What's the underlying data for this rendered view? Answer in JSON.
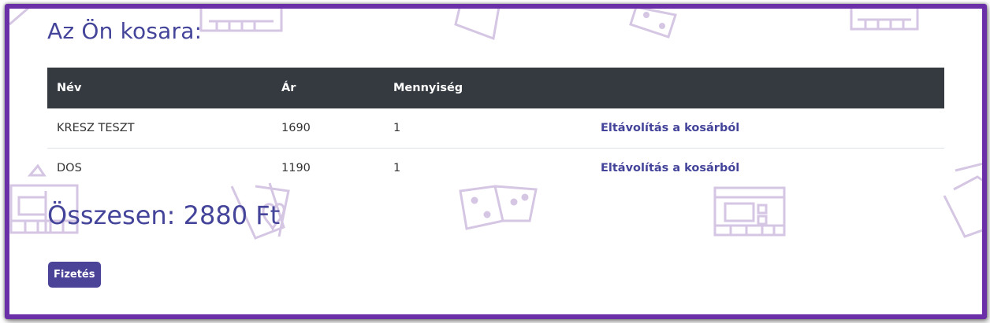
{
  "cart": {
    "title": "Az Ön kosara:",
    "columns": {
      "name": "Név",
      "price": "Ár",
      "quantity": "Mennyiség"
    },
    "items": [
      {
        "name": "KRESZ TESZT",
        "price": "1690",
        "quantity": "1",
        "remove_label": "Eltávolítás a kosárból"
      },
      {
        "name": "DOS",
        "price": "1190",
        "quantity": "1",
        "remove_label": "Eltávolítás a kosárból"
      }
    ],
    "total_label": "Összesen: 2880 Ft",
    "checkout_label": "Fizetés"
  },
  "colors": {
    "frame": "#6b2fa8",
    "accent": "#44449a",
    "table_header": "#343a40",
    "button": "#4b4398",
    "pattern": "#d5c6e4"
  },
  "background_icons": [
    "board-game-icon",
    "dice-icon",
    "playing-cards-icon"
  ]
}
